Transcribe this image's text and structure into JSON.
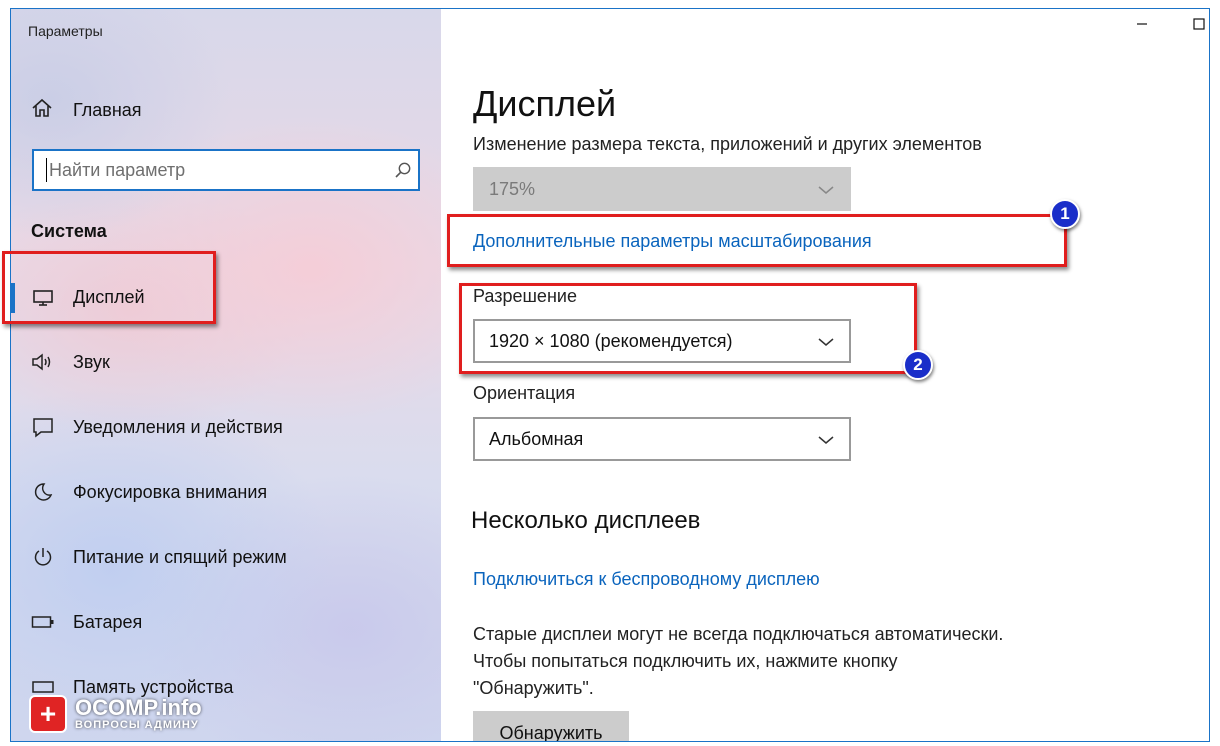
{
  "window": {
    "title": "Параметры"
  },
  "sidebar": {
    "home_label": "Главная",
    "search_placeholder": "Найти параметр",
    "section_label": "Система",
    "items": [
      {
        "label": "Дисплей",
        "icon": "monitor-icon",
        "selected": true
      },
      {
        "label": "Звук",
        "icon": "speaker-icon"
      },
      {
        "label": "Уведомления и действия",
        "icon": "notification-icon"
      },
      {
        "label": "Фокусировка внимания",
        "icon": "moon-icon"
      },
      {
        "label": "Питание и спящий режим",
        "icon": "power-icon"
      },
      {
        "label": "Батарея",
        "icon": "battery-icon"
      },
      {
        "label": "Память устройства",
        "icon": "storage-icon"
      }
    ]
  },
  "main": {
    "title": "Дисплей",
    "scale_label": "Изменение размера текста, приложений и других элементов",
    "scale_value": "175%",
    "advanced_scaling_link": "Дополнительные параметры масштабирования",
    "resolution_label": "Разрешение",
    "resolution_value": "1920 × 1080 (рекомендуется)",
    "orientation_label": "Ориентация",
    "orientation_value": "Альбомная",
    "multi_display_title": "Несколько дисплеев",
    "wireless_link": "Подключиться к беспроводному дисплею",
    "info_lines": [
      "Старые дисплеи могут не всегда подключаться автоматически.",
      "Чтобы попытаться подключить их, нажмите кнопку",
      "\"Обнаружить\"."
    ],
    "detect_button": "Обнаружить"
  },
  "annotations": {
    "badge1": "1",
    "badge2": "2"
  },
  "watermark": {
    "logo": "+",
    "name": "OCOMP.info",
    "tagline": "ВОПРОСЫ АДМИНУ"
  },
  "colors": {
    "accent": "#1a73c7",
    "link": "#0a64bd",
    "highlight": "#e01e1e",
    "badge": "#1a2ec9"
  }
}
